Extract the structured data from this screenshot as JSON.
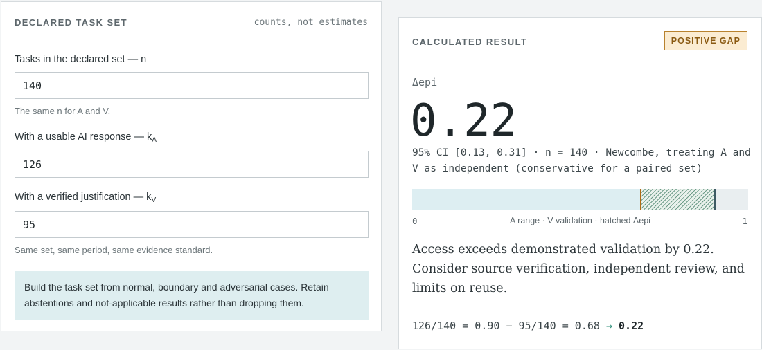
{
  "left": {
    "title": "DECLARED TASK SET",
    "subtitle": "counts, not estimates",
    "fields": [
      {
        "label": "Tasks in the declared set — n",
        "sub": "",
        "value": "140"
      },
      {
        "label": "With a usable AI response — k",
        "sub": "A",
        "value": "126"
      },
      {
        "label": "With a verified justification — k",
        "sub": "V",
        "value": "95"
      }
    ],
    "hint_n": "The same n for A and V.",
    "hint_v": "Same set, same period, same evidence standard.",
    "note": "Build the task set from normal, boundary and adversarial cases. Retain abstentions and not-applicable results rather than dropping them."
  },
  "right": {
    "title": "CALCULATED RESULT",
    "badge": "POSITIVE GAP",
    "metric_label": "Δepi",
    "metric_value": "0.22",
    "ci_text": "95% CI [0.13, 0.31] · n = 140 · Newcombe, treating A and V as independent (conservative for a paired set)",
    "bar": {
      "min_label": "0",
      "max_label": "1",
      "caption": "A range · V validation · hatched Δepi",
      "a_value": 0.9,
      "v_value": 0.68
    },
    "conclusion": "Access exceeds demonstrated validation by 0.22. Consider source verification, independent review, and limits on reuse.",
    "formula_main": "126/140 = 0.90 − 95/140 = 0.68",
    "formula_arrow": "→",
    "formula_result": "0.22"
  },
  "colors": {
    "accent_teal": "#2f8f7a",
    "v_marker": "#b06a14",
    "a_marker": "#3d5a63",
    "badge_bg": "#fbecd2"
  }
}
